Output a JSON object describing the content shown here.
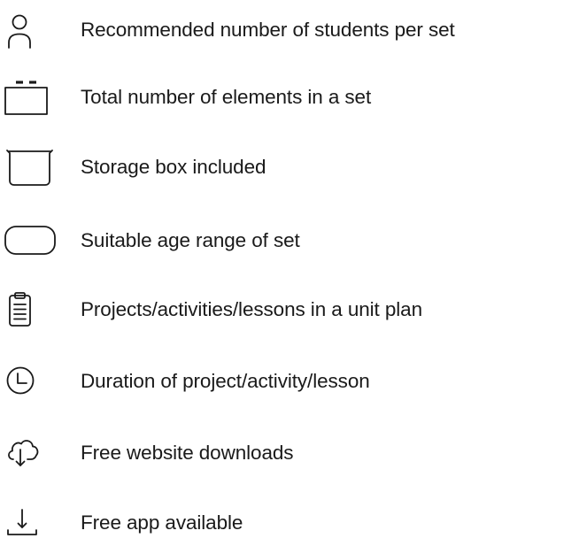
{
  "legend": {
    "items": [
      {
        "icon": "person-icon",
        "label": "Recommended number of students per set"
      },
      {
        "icon": "box-elements-icon",
        "label": "Total number of elements in a set"
      },
      {
        "icon": "storage-bin-icon",
        "label": "Storage box included"
      },
      {
        "icon": "rounded-rectangle-icon",
        "label": "Suitable age range of set"
      },
      {
        "icon": "clipboard-icon",
        "label": "Projects/activities/lessons in a unit plan"
      },
      {
        "icon": "clock-icon",
        "label": "Duration of project/activity/lesson"
      },
      {
        "icon": "cloud-download-icon",
        "label": "Free website downloads"
      },
      {
        "icon": "download-tray-icon",
        "label": "Free app available"
      }
    ]
  }
}
